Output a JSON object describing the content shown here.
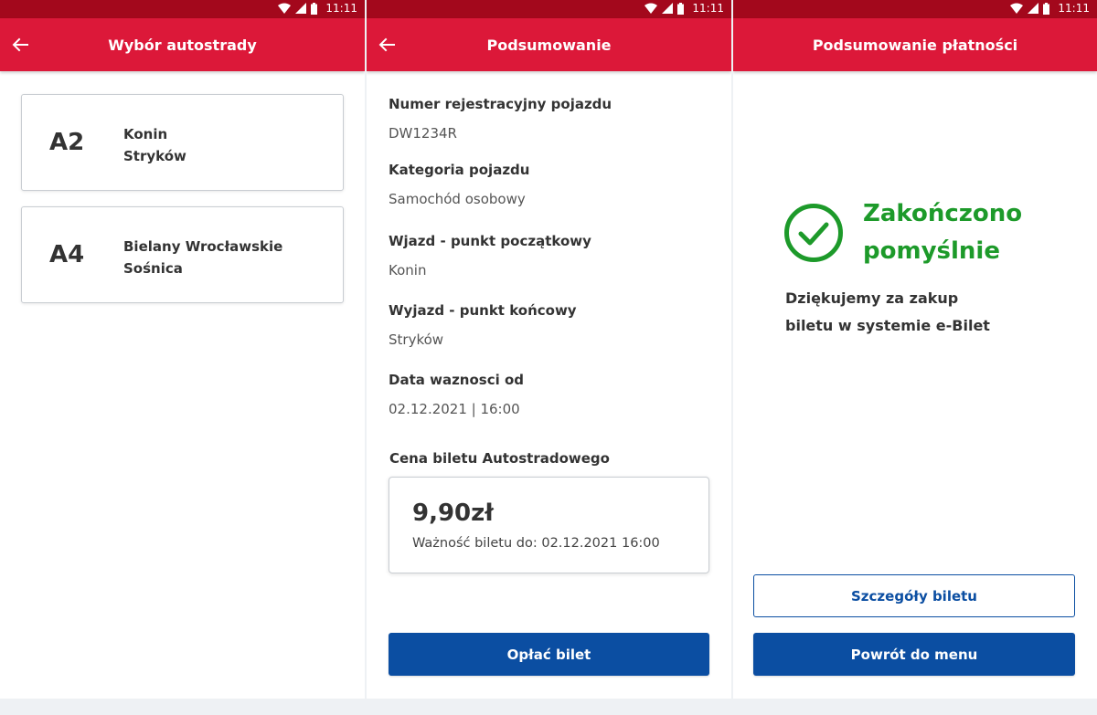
{
  "status": {
    "time": "11:11"
  },
  "screen1": {
    "title": "Wybór autostrady",
    "highways": [
      {
        "code": "A2",
        "from": "Konin",
        "to": "Stryków"
      },
      {
        "code": "A4",
        "from": "Bielany Wrocławskie",
        "to": "Sośnica"
      }
    ]
  },
  "screen2": {
    "title": "Podsumowanie",
    "fields": [
      {
        "label": "Numer rejestracyjny pojazdu",
        "value": "DW1234R"
      },
      {
        "label": "Kategoria pojazdu",
        "value": "Samochód osobowy"
      },
      {
        "label": "Wjazd - punkt początkowy",
        "value": "Konin"
      },
      {
        "label": "Wyjazd - punkt końcowy",
        "value": "Stryków"
      },
      {
        "label": "Data waznosci od",
        "value": "02.12.2021 | 16:00"
      }
    ],
    "price_label": "Cena biletu Autostradowego",
    "price": "9,90zł",
    "valid_until": "Ważność biletu do: 02.12.2021 16:00",
    "pay_button": "Opłać bilet"
  },
  "screen3": {
    "title": "Podsumowanie płatności",
    "success_line1": "Zakończono",
    "success_line2": "pomyślnie",
    "thanks_line1": "Dziękujemy za zakup",
    "thanks_line2": "biletu w systemie e-Bilet",
    "details_button": "Szczegóły biletu",
    "menu_button": "Powrót do menu"
  },
  "colors": {
    "appbar": "#dc1839",
    "statusbar": "#a3081c",
    "primary_button": "#0b4ea2",
    "success": "#1d9a2a"
  },
  "icons": [
    "wifi-icon",
    "signal-icon",
    "battery-icon",
    "back-arrow-icon",
    "check-circle-icon"
  ]
}
